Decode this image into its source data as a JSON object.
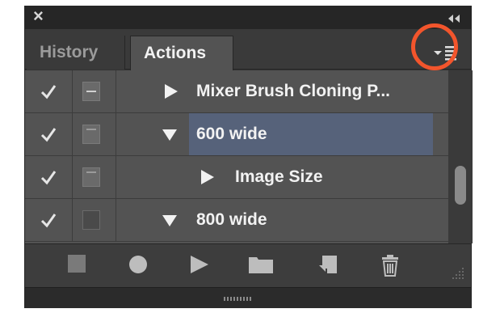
{
  "panel": {
    "tabs": [
      {
        "label": "History",
        "active": false
      },
      {
        "label": "Actions",
        "active": true
      }
    ],
    "close_icon": "close-x-icon",
    "collapse_icon": "double-chevron-right-icon",
    "menu_icon": "panel-flyout-menu-icon"
  },
  "actions": [
    {
      "label": "Mixer Brush Cloning P...",
      "checked": true,
      "dialog": "on",
      "expander": "collapsed",
      "level": 1,
      "selected": false
    },
    {
      "label": "600 wide",
      "checked": true,
      "dialog": "on",
      "expander": "expanded",
      "level": 1,
      "selected": true
    },
    {
      "label": "Image Size",
      "checked": true,
      "dialog": "on",
      "expander": "collapsed",
      "level": 2,
      "selected": false
    },
    {
      "label": "800 wide",
      "checked": true,
      "dialog": "off",
      "expander": "expanded",
      "level": 1,
      "selected": false
    }
  ],
  "toolbar": {
    "buttons": [
      "stop-icon",
      "record-icon",
      "play-icon",
      "new-set-folder-icon",
      "new-action-icon",
      "delete-trash-icon"
    ]
  },
  "colors": {
    "selected_row": "#56627a",
    "annotation": "#f2552c",
    "panel_bg": "#535353"
  }
}
